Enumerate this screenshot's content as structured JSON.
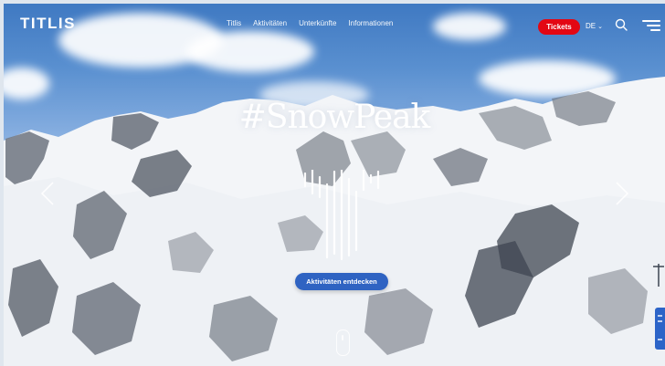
{
  "brand": {
    "logo_text": "TITLIS"
  },
  "nav": {
    "items": [
      {
        "label": "Titlis"
      },
      {
        "label": "Aktivitäten"
      },
      {
        "label": "Unterkünfte"
      },
      {
        "label": "Informationen"
      }
    ]
  },
  "header_actions": {
    "tickets_label": "Tickets",
    "language": "DE",
    "search_icon": "search-icon",
    "menu_icon": "hamburger-menu-icon"
  },
  "hero": {
    "title": "#SnowPeak",
    "cta_label": "Aktivitäten entdecken",
    "prev_icon": "chevron-left-icon",
    "next_icon": "chevron-right-icon"
  },
  "colors": {
    "tickets_red": "#e30713",
    "cta_blue": "#2f63c2",
    "sky_blue": "#3f79c2"
  }
}
